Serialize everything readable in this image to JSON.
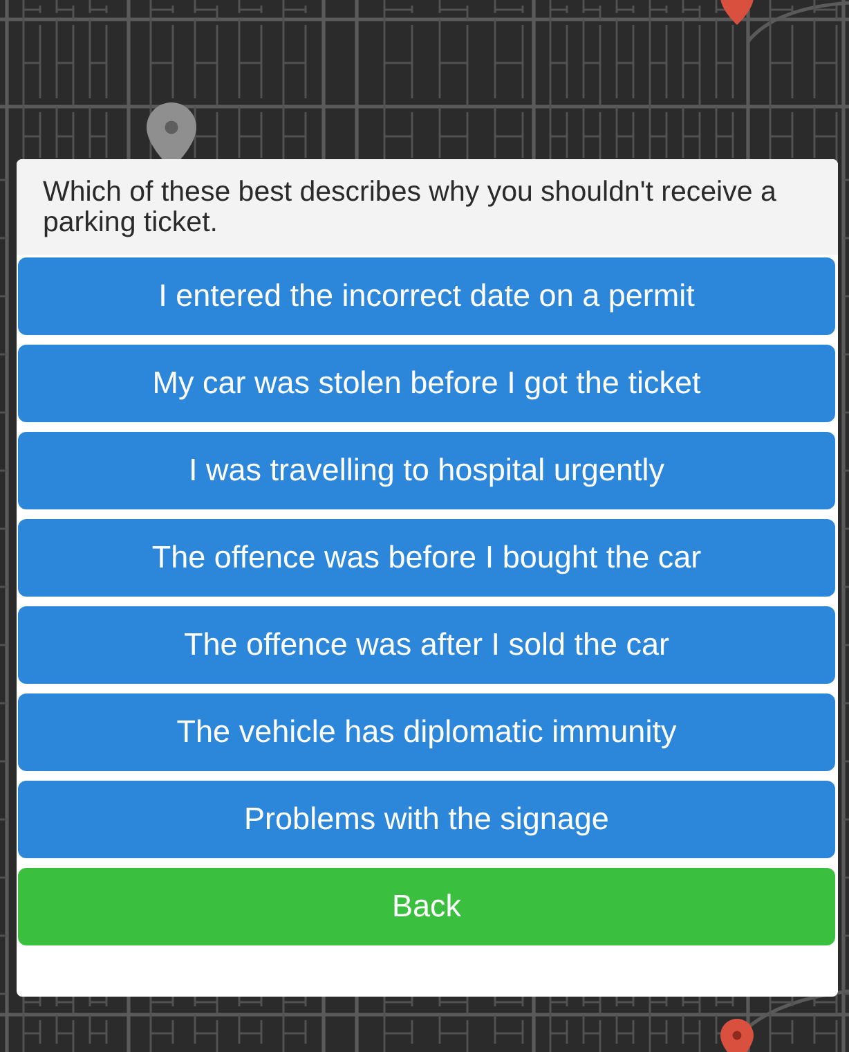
{
  "question": "Which of these best describes why you shouldn't receive a parking ticket.",
  "buttons": [
    {
      "kind": "option",
      "label": "I entered the incorrect date on a permit"
    },
    {
      "kind": "option",
      "label": "My car was stolen before I got the ticket"
    },
    {
      "kind": "option",
      "label": "I was travelling to hospital urgently"
    },
    {
      "kind": "option",
      "label": "The offence was before I bought the car"
    },
    {
      "kind": "option",
      "label": "The offence was after I sold the car"
    },
    {
      "kind": "option",
      "label": "The vehicle has diplomatic immunity"
    },
    {
      "kind": "option",
      "label": "Problems with the signage"
    },
    {
      "kind": "back",
      "label": "Back"
    }
  ]
}
